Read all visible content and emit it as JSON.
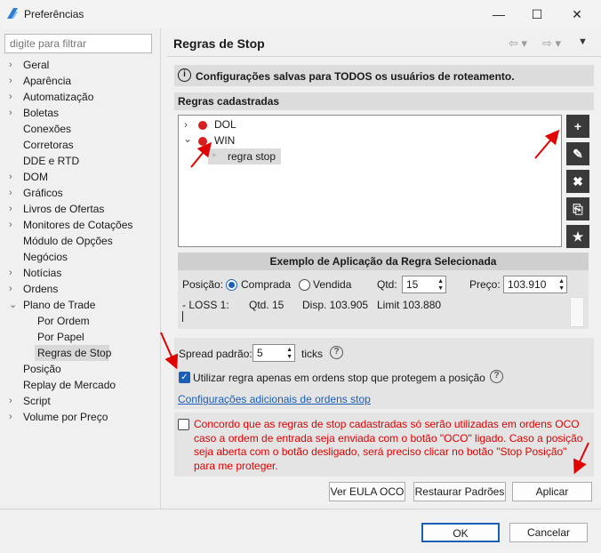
{
  "window": {
    "title": "Preferências",
    "minimize": "—",
    "maximize": "☐",
    "close": "✕"
  },
  "filter": {
    "placeholder": "digite para filtrar"
  },
  "nav": [
    {
      "label": "Geral",
      "arrow": "›"
    },
    {
      "label": "Aparência",
      "arrow": "›"
    },
    {
      "label": "Automatização",
      "arrow": "›"
    },
    {
      "label": "Boletas",
      "arrow": "›"
    },
    {
      "label": "Conexões",
      "arrow": ""
    },
    {
      "label": "Corretoras",
      "arrow": ""
    },
    {
      "label": "DDE e RTD",
      "arrow": ""
    },
    {
      "label": "DOM",
      "arrow": "›"
    },
    {
      "label": "Gráficos",
      "arrow": "›"
    },
    {
      "label": "Livros de Ofertas",
      "arrow": "›"
    },
    {
      "label": "Monitores de Cotações",
      "arrow": "›"
    },
    {
      "label": "Módulo de Opções",
      "arrow": ""
    },
    {
      "label": "Negócios",
      "arrow": ""
    },
    {
      "label": "Notícias",
      "arrow": "›"
    },
    {
      "label": "Ordens",
      "arrow": "›"
    },
    {
      "label": "Plano de Trade",
      "arrow": "⌄"
    },
    {
      "label": "Por Ordem",
      "arrow": "",
      "child": true
    },
    {
      "label": "Por Papel",
      "arrow": "",
      "child": true
    },
    {
      "label": "Regras de Stop",
      "arrow": "",
      "child": true,
      "selected": true
    },
    {
      "label": "Posição",
      "arrow": ""
    },
    {
      "label": "Replay de Mercado",
      "arrow": ""
    },
    {
      "label": "Script",
      "arrow": "›"
    },
    {
      "label": "Volume por Preço",
      "arrow": "›"
    }
  ],
  "page": {
    "title": "Regras de Stop",
    "info": "Configurações salvas para TODOS os usuários de roteamento.",
    "rules_header": "Regras cadastradas",
    "tree": [
      {
        "label": "DOL",
        "expanded": false
      },
      {
        "label": "WIN",
        "expanded": true
      },
      {
        "label": "regra stop",
        "child": true
      }
    ],
    "toolbar": {
      "add": "+",
      "edit": "✎",
      "delete": "✖",
      "copy": "⎘",
      "pin": "★"
    },
    "example": {
      "header": "Exemplo de Aplicação da Regra Selecionada",
      "position_label": "Posição:",
      "buy": "Comprada",
      "sell": "Vendida",
      "qty_label": "Qtd:",
      "qty": "15",
      "price_label": "Preço:",
      "price": "103.910",
      "loss_name": "- LOSS 1:",
      "loss_qty": "Qtd. 15",
      "loss_disp": "Disp. 103.905",
      "loss_limit": "Limit 103.880"
    },
    "spread_label": "Spread padrão:",
    "spread_value": "5",
    "spread_unit": "ticks",
    "protect_label": "Utilizar regra apenas em ordens stop que protegem a posição",
    "extra_link": "Configurações adicionais de ordens stop",
    "agree_text": "Concordo que as regras de stop cadastradas só serão utilizadas em ordens OCO caso a ordem de entrada seja enviada com o botão \"OCO\" ligado. Caso a posição seja aberta com o botão desligado, será preciso clicar no botão \"Stop Posição\" para me proteger.",
    "btn_eula": "Ver EULA OCO",
    "btn_restore": "Restaurar Padrões",
    "btn_apply": "Aplicar"
  },
  "footer": {
    "ok": "OK",
    "cancel": "Cancelar"
  },
  "colors": {
    "accent": "#1a5fb4",
    "warning": "#e00000",
    "dot": "#d62020",
    "link": "#1a5fb4"
  }
}
